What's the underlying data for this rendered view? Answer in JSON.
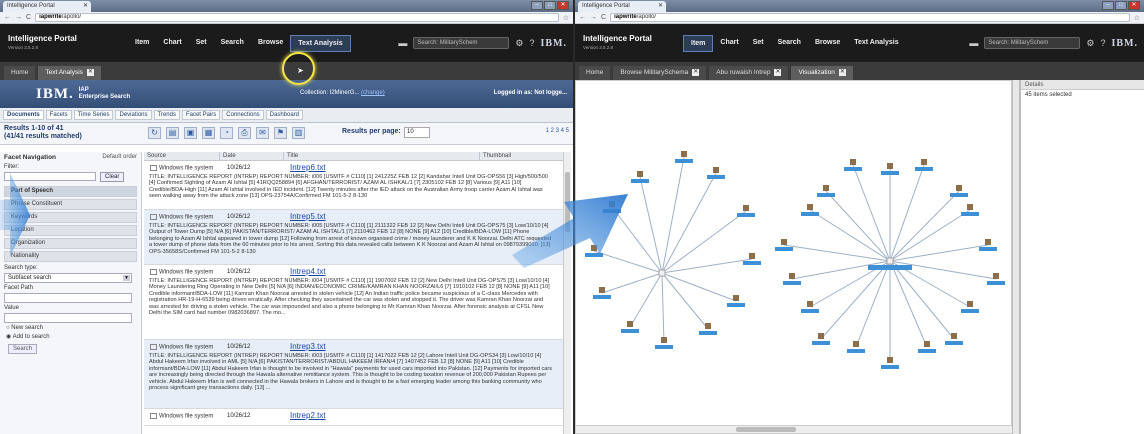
{
  "left": {
    "browser_tab": "Intelligence Portal",
    "url_host": "iapwrite",
    "url_path": "/apollo/",
    "brand": "Intelligence Portal",
    "version": "Version 3.5.2.8",
    "nav": [
      "Item",
      "Chart",
      "Set",
      "Search",
      "Browse",
      "Text Analysis"
    ],
    "search_placeholder": "Search: MilitarySchem",
    "ibm": "IBM.",
    "portal_tabs": [
      "Home",
      "Text Analysis"
    ],
    "es_logo": "IBM.",
    "es_name_1": "IAP",
    "es_name_2": "Enterprise Search",
    "collection_label": "Collection: I2MinerG...",
    "collection_link": "(change)",
    "logged_in": "Logged in as: Not logge...",
    "es_tabs": [
      "Documents",
      "Facets",
      "Time Series",
      "Deviations",
      "Trends",
      "Facet Pairs",
      "Connections",
      "Dashboard"
    ],
    "results_line1": "Results 1-10 of 41",
    "results_line2": "(41/41 results matched)",
    "results_per_page_label": "Results per page:",
    "results_per_page_value": "10",
    "pager": "1 2 3 4 5",
    "facet": {
      "title": "Facet Navigation",
      "default_order": "Default order",
      "filter_label": "Filter:",
      "clear": "Clear",
      "items": [
        "Part of Speech",
        "Phrase Constituent",
        "Keywords",
        "Location",
        "Organization",
        "Nationality"
      ],
      "search_type_label": "Search type:",
      "search_type_value": "Subfacet search",
      "facet_path_label": "Facet Path",
      "value_label": "Value",
      "radio_new": "New search",
      "radio_add": "Add to search",
      "search_btn": "Search"
    },
    "columns": [
      "Source",
      "Date",
      "Title",
      "Thumbnail"
    ],
    "docs": [
      {
        "source": "Windows file system",
        "date": "10/26/12",
        "title": "Intrep6.txt",
        "text": "TITLE: INTELLIGENCE REPORT (INTREP) REPORT NUMBER: i006 [USMTF # C110] [1] 241225Z FEB 12 [2] Kandahar Intell Unit DG-OPS56 [3] High/500/500 [4] Confirmed Sighting of Azam Al Ishtal [5] 41RQQ258894 [6] AFGHAN/TERRORIST/ AZAM AL ISHKAL/1 [7] 2305102 FEB 12 [8] Various [9] A11 [10] Credible/BDA-High [11] Azam Al Ishtal involved in IED incident. [12] Twenty minutes after the IED attack on the Australian Army troop carrier Azam Al Ishtal was seen walking away from the attack zone [13] OPS-23754A/Confirmed FM 101-5-2 8-130"
      },
      {
        "source": "Windows file system",
        "date": "10/26/12",
        "title": "Intrep5.txt",
        "text": "TITLE: INTELLIGENCE REPORT (INTREP) REPORT NUMBER: i005 [USMTF # C110] [1] 2111322 FEB 12 [2] New Delhi Intell Unit DG-OPS75 [3] Low/10/10 [4] Output of Tower Dump [5] N/A [6] PAKISTAN/TERRORIST/ AZAM AL ISHTAL/1 [7] 2110462 FEB 12 [8] NONE [9] A12 [10] Credible/BDA-LOW [11] Phone belonging to Azam Al Ishtal appeared in tower dump [12] Following from arrest of known organised crime / money launderer and K K Noorzai. Delhi ATC requested a tower dump of phone data from the 60 minutes prior to his arrest. Sorting this data revealed calls between K K Noorzai and Azam Al Ishtal on 09879399010. [13] OPS-35658S/Confirmed FM 101-5-2 8-130"
      },
      {
        "source": "Windows file system",
        "date": "10/26/12",
        "title": "Intrep4.txt",
        "text": "TITLE: INTELLIGENCE REPORT (INTREP) REPORT NUMBER: i004 [USMTF # C110] [1] 1907002 FEB 12 [2] New Delhi Intell Unit DG-OPS75 [3] Low/10/10 [4] Money Laundering Ring Operating in New Delhi [5] N/A [6] INDIAN/ECONOMIC CRIME/KAMRAN KHAN NOORZAI/L6 [7] 1910102 FEB 12 [8] NONE [9] A11 [10] Credible informant/BDA-LOW [11] Kamran Khan Noorzai arrested in stolen vehicle [12] An Indian traffic police became suspicious of a C-class Mercedes with registration HR-19-H-6539 being driven erratically. After checking they ascertained the car was stolen and stopped it. The driver was Kamran Khan Noorzai and was arrested for driving a stolen vehicle. The car was impounded and also a phone belonging to Mr Kamran Khan Noorzai. After forensic analysis at CFSL New Delhi the SIM card had number 0982036897. The mo..."
      },
      {
        "source": "Windows file system",
        "date": "10/26/12",
        "title": "Intrep3.txt",
        "text": "TITLE: INTELLIGENCE REPORT (INTREP) REPORT NUMBER: i003 [USMTF # C110] [1] 1417022 FEB 12 [2] Lahore Intell Unit DG-OPS34 [3] Low/10/10 [4] Abdul Hakeem Irfan involved in AML [5] N/A [6] PAKISTAN/TERRORIST/ABDUL HAKEEM IRFAN/4 [7] 1407452 FEB 12 [8] NONE [9] A11 [10] Credible informant/BDA-LOW [11] Abdul Hakeem Irfan is thought to be involved in \"Hawala\" payments for used cars imported into Pakistan. [12] Payments for imported cars are increasingly being directed through the Hawala alternative remittance system. This is thought to be costing taxation revenue of 200,000 Pakistan Rupees per vehicle. Abdul Hakeem Irfan is well connected in the Hawala brokers in Lahore and is thought to be a fast emerging leader among this banking community who process significant grey transactions daily. [13] ..."
      },
      {
        "source": "Windows file system",
        "date": "10/26/12",
        "title": "Intrep2.txt",
        "text": ""
      }
    ]
  },
  "right": {
    "browser_tab": "Intelligence Portal",
    "url_host": "iapwrite",
    "url_path": "/apollo/",
    "brand": "Intelligence Portal",
    "version": "Version 3.5.2.8",
    "nav": [
      "Item",
      "Chart",
      "Set",
      "Search",
      "Browse",
      "Text Analysis"
    ],
    "search_placeholder": "Search: MilitarySchem",
    "ibm": "IBM.",
    "portal_tabs": [
      "Home",
      "Browse MilitarySchema",
      "Abu ruwaish Intrep",
      "Visualization"
    ],
    "details_title": "Details",
    "details_info": "45 items selected"
  },
  "colors": {
    "accent": "#5c7fb5",
    "node": "#3d8fd6",
    "edge": "#9db0c6",
    "highlight": "#f5e646"
  }
}
